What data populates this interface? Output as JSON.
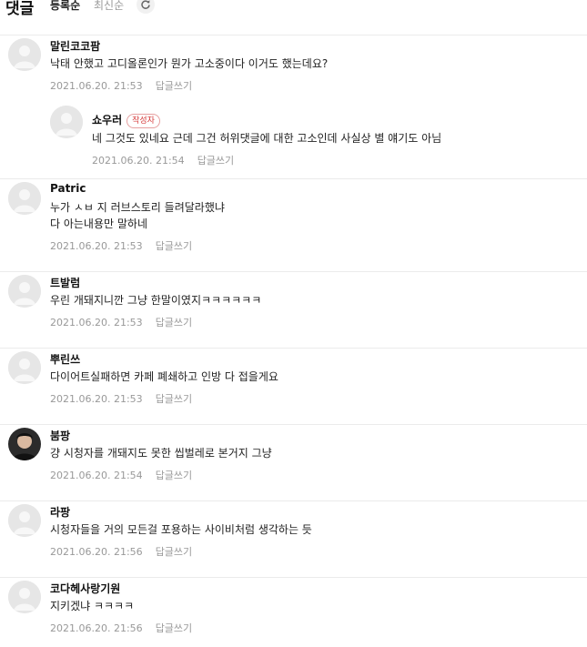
{
  "header": {
    "title": "댓글",
    "sort_registered": "등록순",
    "sort_latest": "최신순",
    "refresh_icon": "refresh-icon"
  },
  "comments": [
    {
      "nickname": "말린코코팜",
      "lines": [
        "낙태 안했고 고디올론인가 뭔가 고소중이다 이거도 했는데요?"
      ],
      "date": "2021.06.20. 21:53",
      "reply_label": "답글쓰기",
      "avatar": "default"
    },
    {
      "nickname": "쇼우러",
      "badge": "작성자",
      "lines": [
        "네 그것도 있네요 근데 그건 허위댓글에 대한 고소인데 사실상 별 얘기도 아님"
      ],
      "date": "2021.06.20. 21:54",
      "reply_label": "답글쓰기",
      "avatar": "default",
      "is_reply": true
    },
    {
      "nickname": "Patric",
      "lines": [
        "누가 ㅅㅂ 지 러브스토리 들려달라했냐",
        "다 아는내용만 말하네"
      ],
      "date": "2021.06.20. 21:53",
      "reply_label": "답글쓰기",
      "avatar": "default"
    },
    {
      "nickname": "트발럼",
      "lines": [
        "우린 개돼지니깐 그냥 한말이였지ㅋㅋㅋㅋㅋㅋ"
      ],
      "date": "2021.06.20. 21:53",
      "reply_label": "답글쓰기",
      "avatar": "default"
    },
    {
      "nickname": "뿌린쓰",
      "lines": [
        "다이어트실패하면 카페 폐쇄하고 인방 다 접을게요"
      ],
      "date": "2021.06.20. 21:53",
      "reply_label": "답글쓰기",
      "avatar": "default"
    },
    {
      "nickname": "붐팡",
      "lines": [
        "걍 시청자를 개돼지도 못한 씹벌레로 본거지 그냥"
      ],
      "date": "2021.06.20. 21:54",
      "reply_label": "답글쓰기",
      "avatar": "photo"
    },
    {
      "nickname": "라팡",
      "lines": [
        "시청자들을 거의 모든걸 포용하는 사이비처럼 생각하는 듯"
      ],
      "date": "2021.06.20. 21:56",
      "reply_label": "답글쓰기",
      "avatar": "default"
    },
    {
      "nickname": "코다헤사랑기원",
      "lines": [
        "지키겠냐 ㅋㅋㅋㅋ"
      ],
      "date": "2021.06.20. 21:56",
      "reply_label": "답글쓰기",
      "avatar": "default"
    }
  ]
}
